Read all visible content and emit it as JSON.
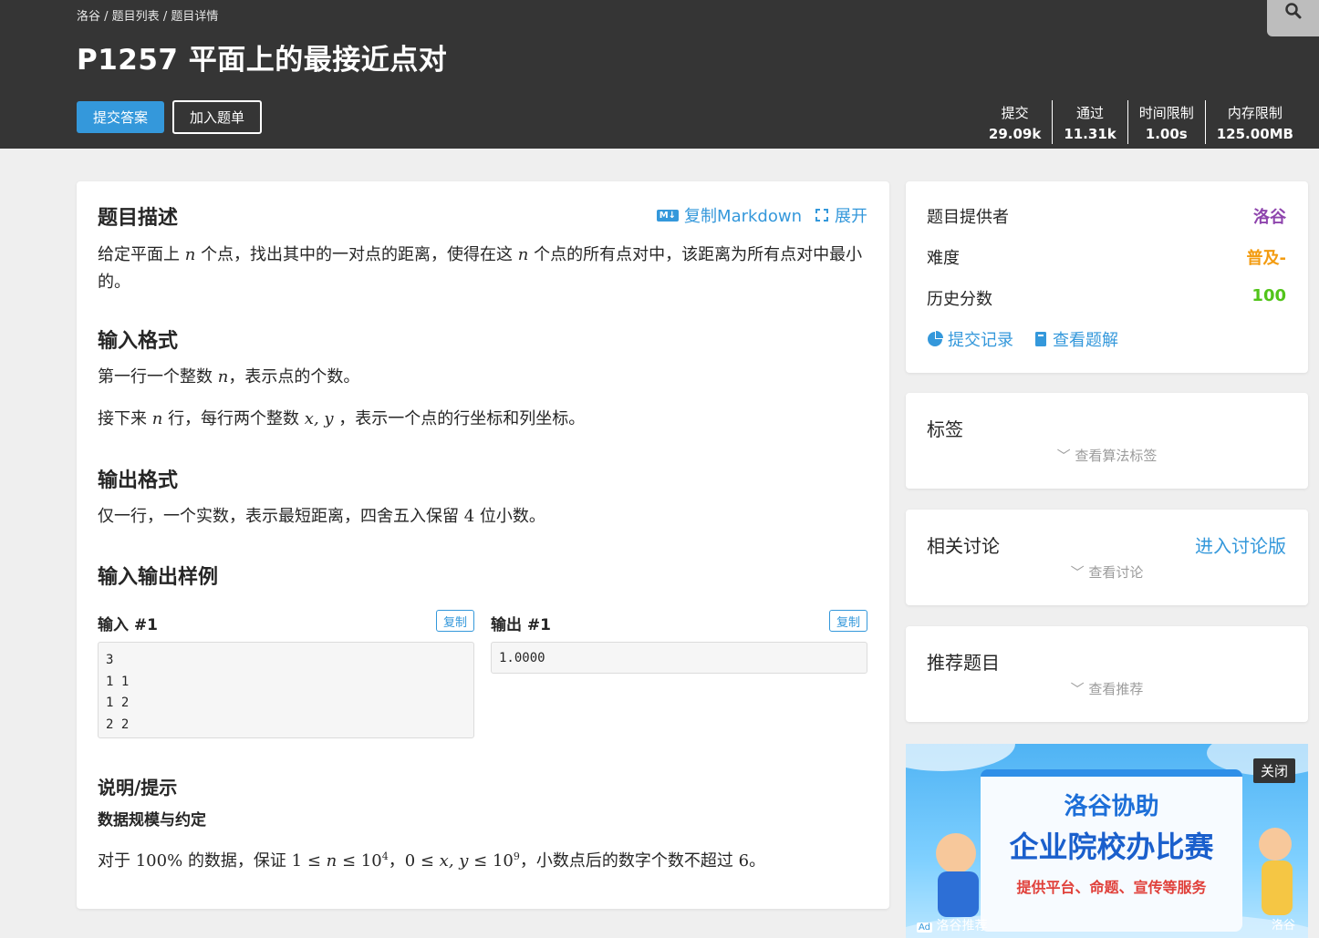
{
  "header": {
    "breadcrumb": [
      "洛谷",
      "题目列表",
      "题目详情"
    ],
    "title": "P1257 平面上的最接近点对",
    "submit_label": "提交答案",
    "add_list_label": "加入题单",
    "stats": [
      {
        "label": "提交",
        "value": "29.09k"
      },
      {
        "label": "通过",
        "value": "11.31k"
      },
      {
        "label": "时间限制",
        "value": "1.00s"
      },
      {
        "label": "内存限制",
        "value": "125.00MB"
      }
    ]
  },
  "problem": {
    "desc_heading": "题目描述",
    "copy_md_label": "复制Markdown",
    "md_badge": "M↓",
    "expand_label": "展开",
    "desc_p1": "给定平面上",
    "desc_n": "n",
    "desc_p2": "个点，找出其中的一对点的距离，使得在这",
    "desc_p3": "个点的所有点对中，该距离为所有点对中最小",
    "desc_p4": "的。",
    "input_heading": "输入格式",
    "input_l1a": "第一行一个整数",
    "input_l1b": "，表示点的个数。",
    "input_l2a": "接下来",
    "input_l2b": "行，每行两个整数",
    "input_xy": "x, y",
    "input_l2c": "，表示一个点的行坐标和列坐标。",
    "output_heading": "输出格式",
    "output_l1a": "仅一行，一个实数，表示最短距离，四舍五入保留",
    "output_4": "4",
    "output_l1b": "位小数。",
    "samples_heading": "输入输出样例",
    "input1_label": "输入 #1",
    "output1_label": "输出 #1",
    "copy_label": "复制",
    "input1_lines": [
      "3",
      "1 1",
      "1 2",
      "2 2"
    ],
    "output1_lines": [
      "1.0000"
    ],
    "hint_heading": "说明/提示",
    "hint_sub": "数据规模与约定",
    "hint_a": "对于",
    "hint_pct": "100%",
    "hint_b": "的数据，保证",
    "hint_c": "，小数点后的数字个数不超过",
    "hint_6": "6",
    "hint_d": "。"
  },
  "sidebar": {
    "provider_label": "题目提供者",
    "provider_value": "洛谷",
    "difficulty_label": "难度",
    "difficulty_value": "普及-",
    "score_label": "历史分数",
    "score_value": "100",
    "records_label": "提交记录",
    "solutions_label": "查看题解",
    "tags_title": "标签",
    "tags_more": "查看算法标签",
    "discuss_title": "相关讨论",
    "discuss_link": "进入讨论版",
    "discuss_more": "查看讨论",
    "recommend_title": "推荐题目",
    "recommend_more": "查看推荐"
  },
  "ad": {
    "line1": "洛谷协助",
    "line2": "企业院校办比赛",
    "line3": "提供平台、命题、宣传等服务",
    "close_label": "关闭",
    "tag": "洛谷推荐",
    "brand": "洛谷"
  },
  "colors": {
    "accent": "#3498db",
    "provider": "#8e44ad",
    "difficulty": "#f39c11",
    "score": "#52c41a",
    "header_bg": "#353535"
  }
}
